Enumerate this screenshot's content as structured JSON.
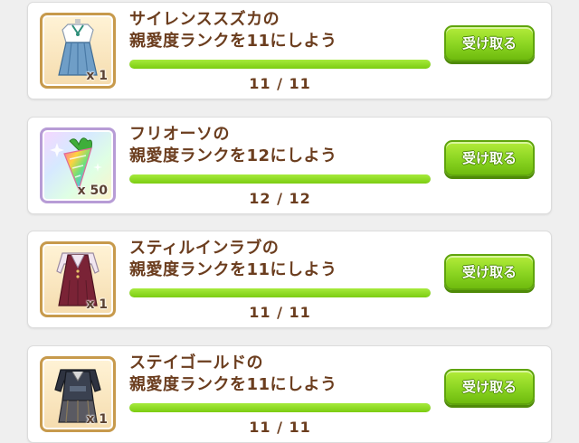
{
  "missions": [
    {
      "title": "サイレンススズカの\n親愛度ランクを11にしよう",
      "progress_text": "11 / 11",
      "progress": 1.0,
      "reward_icon": "outfit-blue-skirt-icon",
      "reward_qty": "x 1",
      "frame": "gold",
      "button_label": "受け取る"
    },
    {
      "title": "フリオーソの\n親愛度ランクを12にしよう",
      "progress_text": "12 / 12",
      "progress": 1.0,
      "reward_icon": "rainbow-carrot-icon",
      "reward_qty": "x 50",
      "frame": "rainbow",
      "button_label": "受け取る"
    },
    {
      "title": "スティルインラブの\n親愛度ランクを11にしよう",
      "progress_text": "11 / 11",
      "progress": 1.0,
      "reward_icon": "outfit-maroon-dress-icon",
      "reward_qty": "x 1",
      "frame": "gold",
      "button_label": "受け取る"
    },
    {
      "title": "ステイゴールドの\n親愛度ランクを11にしよう",
      "progress_text": "11 / 11",
      "progress": 1.0,
      "reward_icon": "outfit-dark-jacket-icon",
      "reward_qty": "x 1",
      "frame": "gold",
      "button_label": "受け取る"
    }
  ],
  "colors": {
    "title_text": "#6b3d1e",
    "bar_fill": "#8ad421",
    "button": "#8ad421",
    "frame_gold": "#c79a4c",
    "frame_rainbow": "#b79cd6"
  }
}
